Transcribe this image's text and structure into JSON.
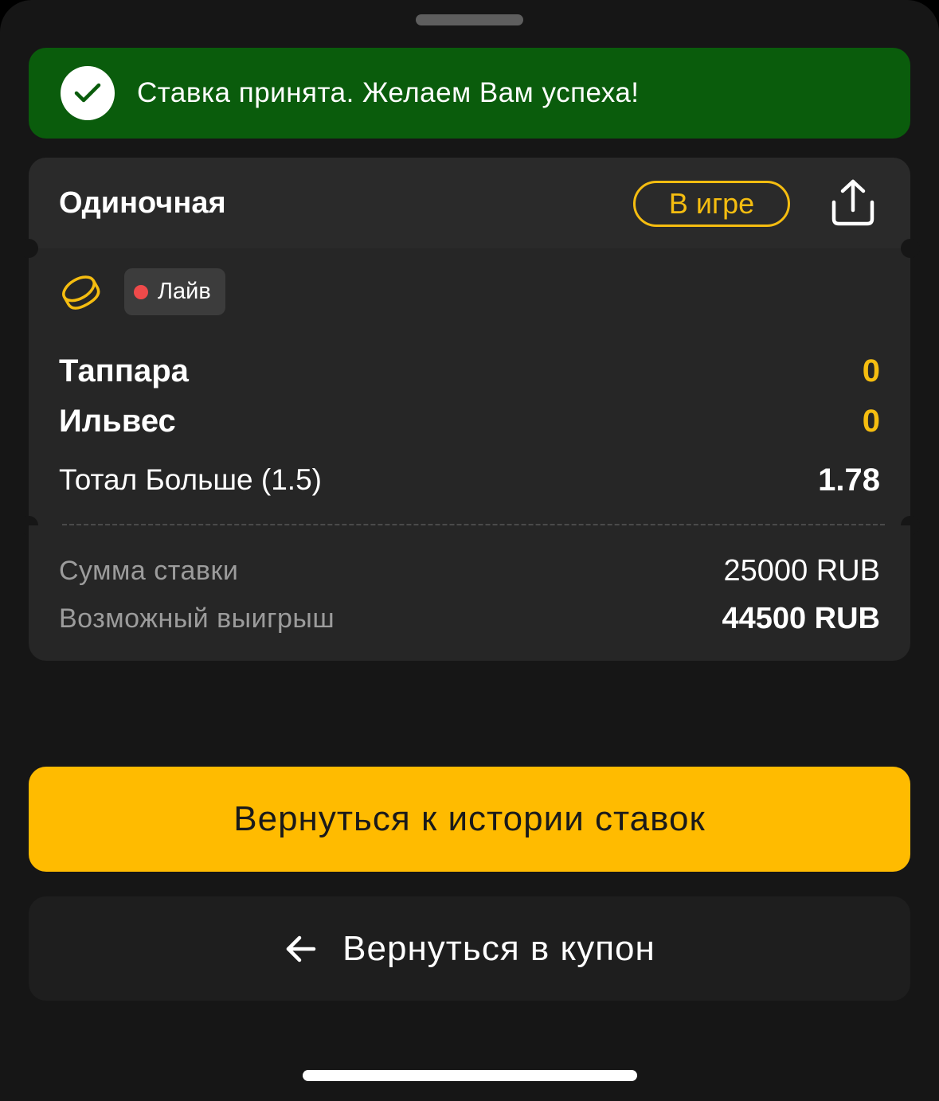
{
  "toast": {
    "message": "Ставка принята. Желаем Вам успеха!",
    "icon": "check-icon",
    "color": "#0a5c0c"
  },
  "bet": {
    "type": "Одиночная",
    "status": "В игре",
    "share_icon": "share-icon",
    "sport_icon": "hockey-puck-icon",
    "live_label": "Лайв",
    "team1": {
      "name": "Таппара",
      "score": "0"
    },
    "team2": {
      "name": "Ильвес",
      "score": "0"
    },
    "market": "Тотал Больше (1.5)",
    "odds": "1.78"
  },
  "summary": {
    "stake_label": "Сумма ставки",
    "stake_value": "25000 RUB",
    "win_label": "Возможный выигрыш",
    "win_value": "44500 RUB"
  },
  "actions": {
    "history_label": "Вернуться к истории ставок",
    "coupon_label": "Вернуться в купон",
    "coupon_icon": "arrow-left-icon"
  },
  "colors": {
    "accent": "#ffbb00",
    "live": "#ef4a4a",
    "background": "#161616"
  }
}
